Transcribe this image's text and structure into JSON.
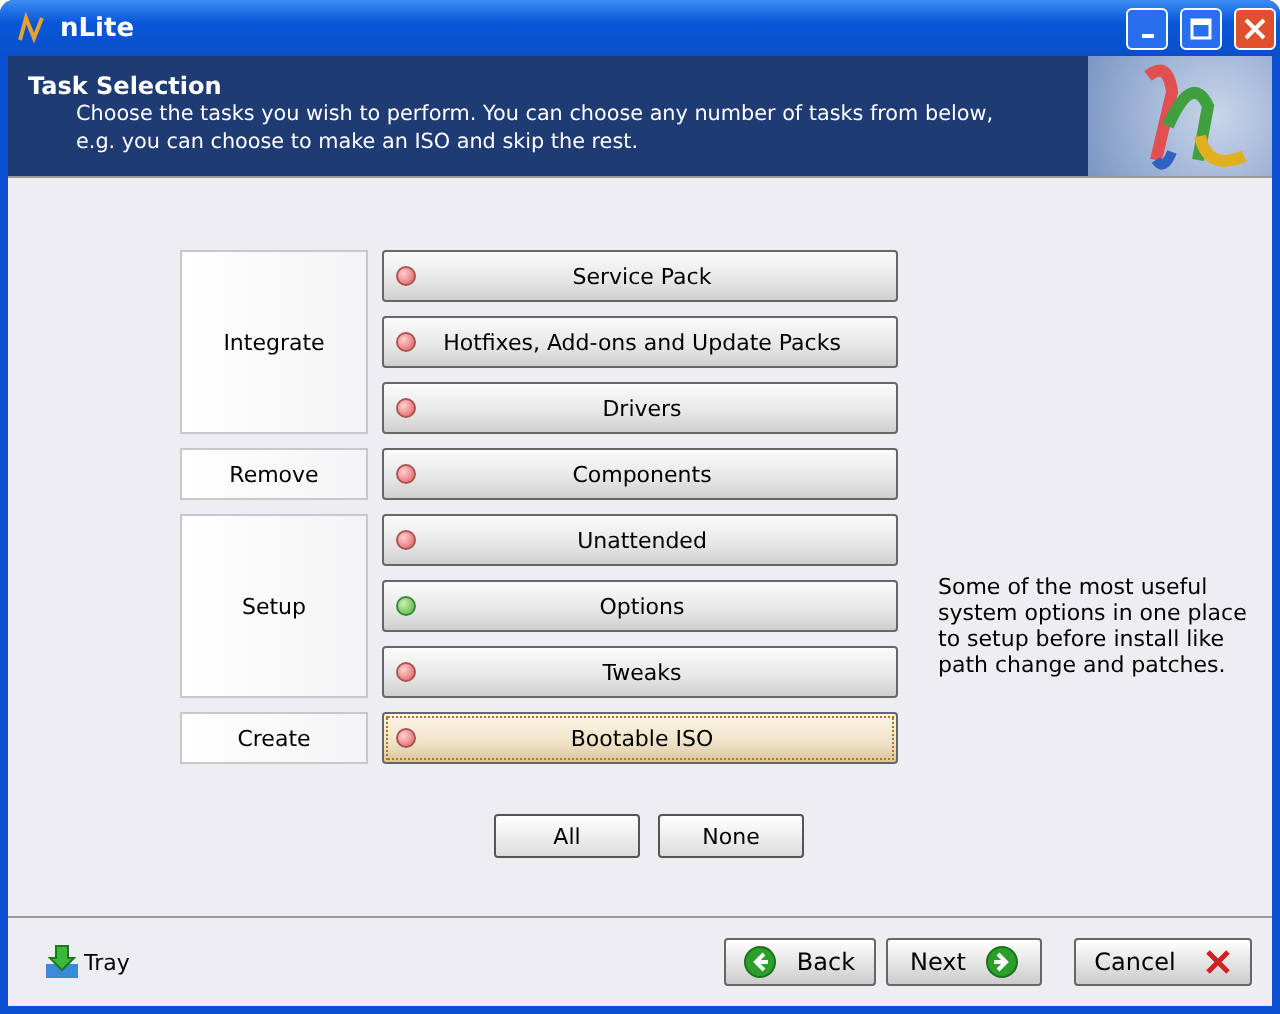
{
  "window": {
    "title": "nLite"
  },
  "header": {
    "title": "Task Selection",
    "description": "Choose the tasks you wish to perform. You can choose any number of tasks from below, e.g. you can choose to make an ISO and skip the rest."
  },
  "groups": [
    {
      "label": "Integrate",
      "tasks": [
        {
          "label": "Service Pack",
          "on": false,
          "focused": false
        },
        {
          "label": "Hotfixes, Add-ons and Update Packs",
          "on": false,
          "focused": false
        },
        {
          "label": "Drivers",
          "on": false,
          "focused": false
        }
      ]
    },
    {
      "label": "Remove",
      "tasks": [
        {
          "label": "Components",
          "on": false,
          "focused": false
        }
      ]
    },
    {
      "label": "Setup",
      "tasks": [
        {
          "label": "Unattended",
          "on": false,
          "focused": false
        },
        {
          "label": "Options",
          "on": true,
          "focused": false
        },
        {
          "label": "Tweaks",
          "on": false,
          "focused": false
        }
      ]
    },
    {
      "label": "Create",
      "tasks": [
        {
          "label": "Bootable ISO",
          "on": false,
          "focused": true
        }
      ]
    }
  ],
  "hint": "Some of the most useful system options in one place to setup before install like path change and patches.",
  "select_buttons": [
    "All",
    "None"
  ],
  "footer": {
    "tray": "Tray",
    "back": "Back",
    "next": "Next",
    "cancel": "Cancel"
  }
}
